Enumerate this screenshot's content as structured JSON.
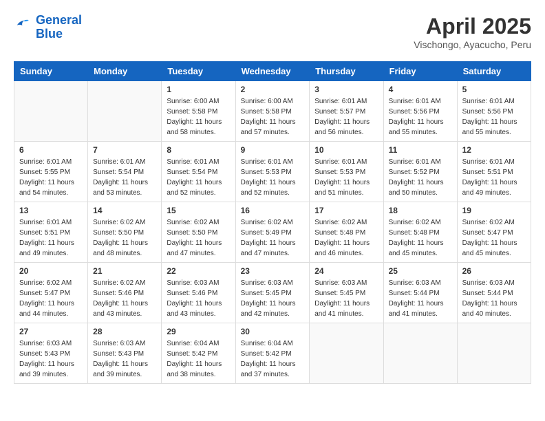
{
  "header": {
    "logo_line1": "General",
    "logo_line2": "Blue",
    "title": "April 2025",
    "location": "Vischongo, Ayacucho, Peru"
  },
  "weekdays": [
    "Sunday",
    "Monday",
    "Tuesday",
    "Wednesday",
    "Thursday",
    "Friday",
    "Saturday"
  ],
  "weeks": [
    [
      {
        "day": "",
        "detail": ""
      },
      {
        "day": "",
        "detail": ""
      },
      {
        "day": "1",
        "detail": "Sunrise: 6:00 AM\nSunset: 5:58 PM\nDaylight: 11 hours and 58 minutes."
      },
      {
        "day": "2",
        "detail": "Sunrise: 6:00 AM\nSunset: 5:58 PM\nDaylight: 11 hours and 57 minutes."
      },
      {
        "day": "3",
        "detail": "Sunrise: 6:01 AM\nSunset: 5:57 PM\nDaylight: 11 hours and 56 minutes."
      },
      {
        "day": "4",
        "detail": "Sunrise: 6:01 AM\nSunset: 5:56 PM\nDaylight: 11 hours and 55 minutes."
      },
      {
        "day": "5",
        "detail": "Sunrise: 6:01 AM\nSunset: 5:56 PM\nDaylight: 11 hours and 55 minutes."
      }
    ],
    [
      {
        "day": "6",
        "detail": "Sunrise: 6:01 AM\nSunset: 5:55 PM\nDaylight: 11 hours and 54 minutes."
      },
      {
        "day": "7",
        "detail": "Sunrise: 6:01 AM\nSunset: 5:54 PM\nDaylight: 11 hours and 53 minutes."
      },
      {
        "day": "8",
        "detail": "Sunrise: 6:01 AM\nSunset: 5:54 PM\nDaylight: 11 hours and 52 minutes."
      },
      {
        "day": "9",
        "detail": "Sunrise: 6:01 AM\nSunset: 5:53 PM\nDaylight: 11 hours and 52 minutes."
      },
      {
        "day": "10",
        "detail": "Sunrise: 6:01 AM\nSunset: 5:53 PM\nDaylight: 11 hours and 51 minutes."
      },
      {
        "day": "11",
        "detail": "Sunrise: 6:01 AM\nSunset: 5:52 PM\nDaylight: 11 hours and 50 minutes."
      },
      {
        "day": "12",
        "detail": "Sunrise: 6:01 AM\nSunset: 5:51 PM\nDaylight: 11 hours and 49 minutes."
      }
    ],
    [
      {
        "day": "13",
        "detail": "Sunrise: 6:01 AM\nSunset: 5:51 PM\nDaylight: 11 hours and 49 minutes."
      },
      {
        "day": "14",
        "detail": "Sunrise: 6:02 AM\nSunset: 5:50 PM\nDaylight: 11 hours and 48 minutes."
      },
      {
        "day": "15",
        "detail": "Sunrise: 6:02 AM\nSunset: 5:50 PM\nDaylight: 11 hours and 47 minutes."
      },
      {
        "day": "16",
        "detail": "Sunrise: 6:02 AM\nSunset: 5:49 PM\nDaylight: 11 hours and 47 minutes."
      },
      {
        "day": "17",
        "detail": "Sunrise: 6:02 AM\nSunset: 5:48 PM\nDaylight: 11 hours and 46 minutes."
      },
      {
        "day": "18",
        "detail": "Sunrise: 6:02 AM\nSunset: 5:48 PM\nDaylight: 11 hours and 45 minutes."
      },
      {
        "day": "19",
        "detail": "Sunrise: 6:02 AM\nSunset: 5:47 PM\nDaylight: 11 hours and 45 minutes."
      }
    ],
    [
      {
        "day": "20",
        "detail": "Sunrise: 6:02 AM\nSunset: 5:47 PM\nDaylight: 11 hours and 44 minutes."
      },
      {
        "day": "21",
        "detail": "Sunrise: 6:02 AM\nSunset: 5:46 PM\nDaylight: 11 hours and 43 minutes."
      },
      {
        "day": "22",
        "detail": "Sunrise: 6:03 AM\nSunset: 5:46 PM\nDaylight: 11 hours and 43 minutes."
      },
      {
        "day": "23",
        "detail": "Sunrise: 6:03 AM\nSunset: 5:45 PM\nDaylight: 11 hours and 42 minutes."
      },
      {
        "day": "24",
        "detail": "Sunrise: 6:03 AM\nSunset: 5:45 PM\nDaylight: 11 hours and 41 minutes."
      },
      {
        "day": "25",
        "detail": "Sunrise: 6:03 AM\nSunset: 5:44 PM\nDaylight: 11 hours and 41 minutes."
      },
      {
        "day": "26",
        "detail": "Sunrise: 6:03 AM\nSunset: 5:44 PM\nDaylight: 11 hours and 40 minutes."
      }
    ],
    [
      {
        "day": "27",
        "detail": "Sunrise: 6:03 AM\nSunset: 5:43 PM\nDaylight: 11 hours and 39 minutes."
      },
      {
        "day": "28",
        "detail": "Sunrise: 6:03 AM\nSunset: 5:43 PM\nDaylight: 11 hours and 39 minutes."
      },
      {
        "day": "29",
        "detail": "Sunrise: 6:04 AM\nSunset: 5:42 PM\nDaylight: 11 hours and 38 minutes."
      },
      {
        "day": "30",
        "detail": "Sunrise: 6:04 AM\nSunset: 5:42 PM\nDaylight: 11 hours and 37 minutes."
      },
      {
        "day": "",
        "detail": ""
      },
      {
        "day": "",
        "detail": ""
      },
      {
        "day": "",
        "detail": ""
      }
    ]
  ]
}
